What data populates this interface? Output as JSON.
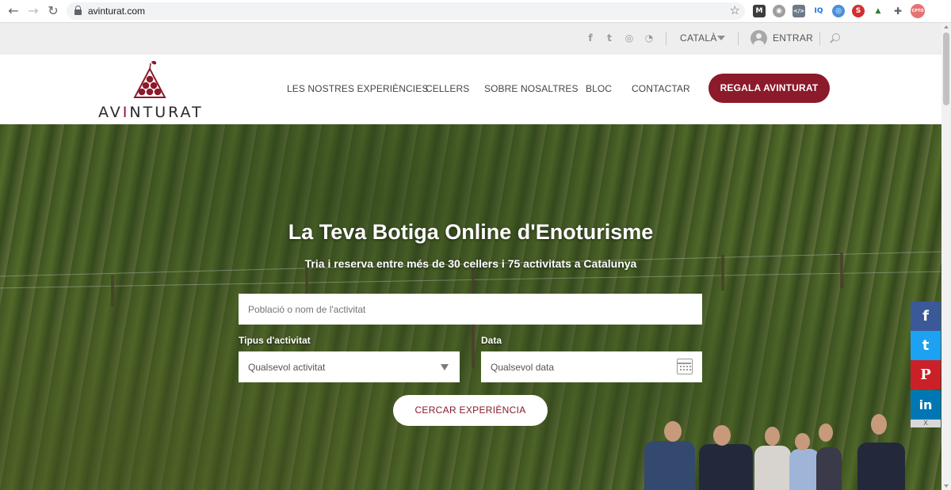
{
  "browser": {
    "url": "avinturat.com",
    "extensions": [
      "M",
      "◉",
      "</>",
      "IQ",
      "◎",
      "S",
      "▲",
      "✚",
      "CPTO"
    ]
  },
  "utility_bar": {
    "social": [
      "f",
      "t",
      "◎",
      "◔"
    ],
    "language": "CATALÀ",
    "login": "ENTRAR"
  },
  "header": {
    "logo": {
      "prefix": "AV",
      "accent": "I",
      "suffix": "NTURAT"
    },
    "menu": [
      "LES NOSTRES EXPERIÈNCIES",
      "CELLERS",
      "SOBRE NOSALTRES",
      "BLOC",
      "CONTACTAR"
    ],
    "cta": "REGALA AVINTURAT"
  },
  "hero": {
    "title": "La Teva Botiga Online d'Enoturisme",
    "subtitle": "Tria i reserva entre més de 30 cellers i 75 activitats a Catalunya",
    "search_placeholder": "Població o nom de l'activitat",
    "type_label": "Tipus d'activitat",
    "type_value": "Qualsevol activitat",
    "date_label": "Data",
    "date_value": "Qualsevol data",
    "search_button": "CERCAR EXPERIÈNCIA"
  },
  "share": {
    "facebook": "f",
    "twitter": "t",
    "pinterest": "P",
    "linkedin": "in",
    "close": "X"
  },
  "colors": {
    "brand": "#8b1a2b",
    "facebook": "#3b5998",
    "twitter": "#1da1f2",
    "pinterest": "#cb2027",
    "linkedin": "#0077b5"
  }
}
